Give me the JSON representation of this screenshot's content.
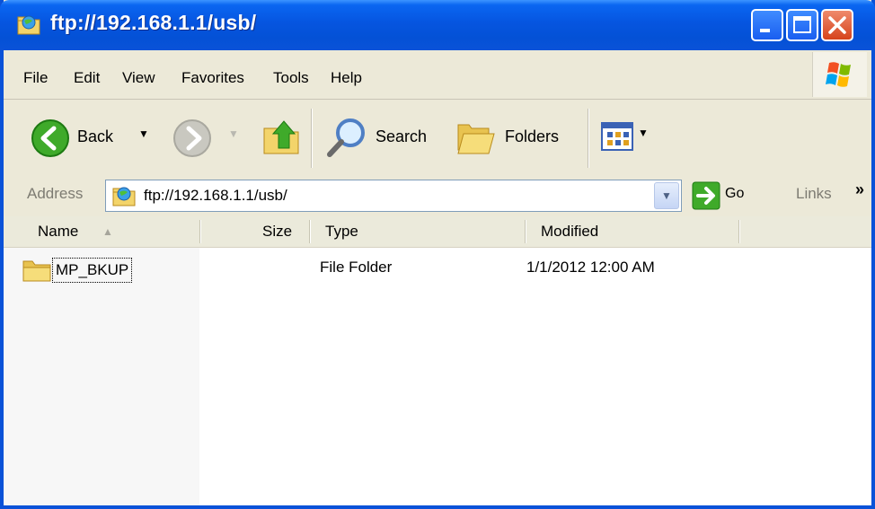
{
  "window": {
    "title": "ftp://192.168.1.1/usb/"
  },
  "menu": [
    "File",
    "Edit",
    "View",
    "Favorites",
    "Tools",
    "Help"
  ],
  "toolbar": {
    "back_label": "Back",
    "search_label": "Search",
    "folders_label": "Folders"
  },
  "address": {
    "label": "Address",
    "value": "ftp://192.168.1.1/usb/",
    "go_label": "Go",
    "links_label": "Links",
    "links_chevron": "»"
  },
  "columns": {
    "name": "Name",
    "size": "Size",
    "type": "Type",
    "modified": "Modified"
  },
  "files": [
    {
      "name": "MP_BKUP",
      "size": "",
      "type": "File Folder",
      "modified": "1/1/2012 12:00 AM"
    }
  ],
  "colors": {
    "titlebar": "#0451d6",
    "close_button": "#d6431c",
    "chrome": "#ece9d8"
  },
  "icons": [
    "globe-folder-icon",
    "minimize-icon",
    "maximize-icon",
    "close-icon",
    "windows-logo-icon",
    "back-arrow-icon",
    "forward-arrow-icon",
    "up-folder-icon",
    "search-magnifier-icon",
    "folders-icon",
    "views-icon",
    "go-arrow-icon",
    "folder-icon"
  ]
}
